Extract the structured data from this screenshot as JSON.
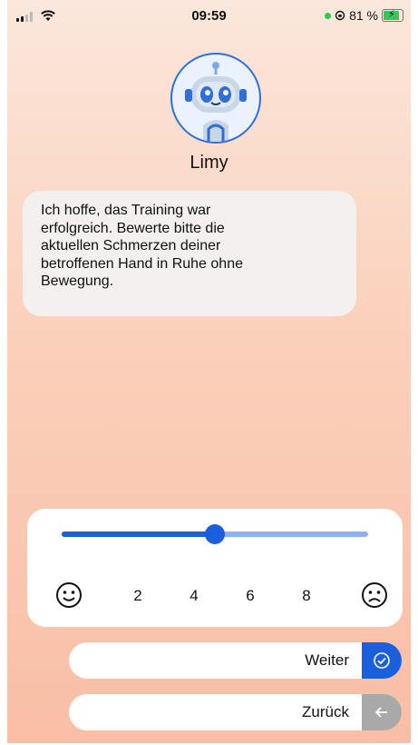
{
  "status_bar": {
    "time": "09:59",
    "battery": "81 %",
    "colors": {
      "location_dot": "#2ecc40",
      "battery_fill": "#34c759"
    }
  },
  "assistant": {
    "name": "Limy",
    "message": "Ich hoffe, das Training war\nerfolgreich. Bewerte bitte die\naktuellen Schmerzen deiner\nbetroffenen Hand in Ruhe ohne\nBewegung."
  },
  "pain_slider": {
    "min": 0,
    "max": 10,
    "value": 5,
    "tick_labels": [
      "2",
      "4",
      "6",
      "8"
    ],
    "left_icon": "smiley-happy-icon",
    "right_icon": "smiley-sad-icon",
    "colors": {
      "active": "#1a5fdc",
      "inactive": "#8ab3f5"
    }
  },
  "buttons": {
    "next": {
      "label": "Weiter",
      "icon": "check-circle-icon",
      "color": "#1a5fdc"
    },
    "back": {
      "label": "Zurück",
      "icon": "arrow-left-icon",
      "color": "#a9a9a9"
    }
  }
}
